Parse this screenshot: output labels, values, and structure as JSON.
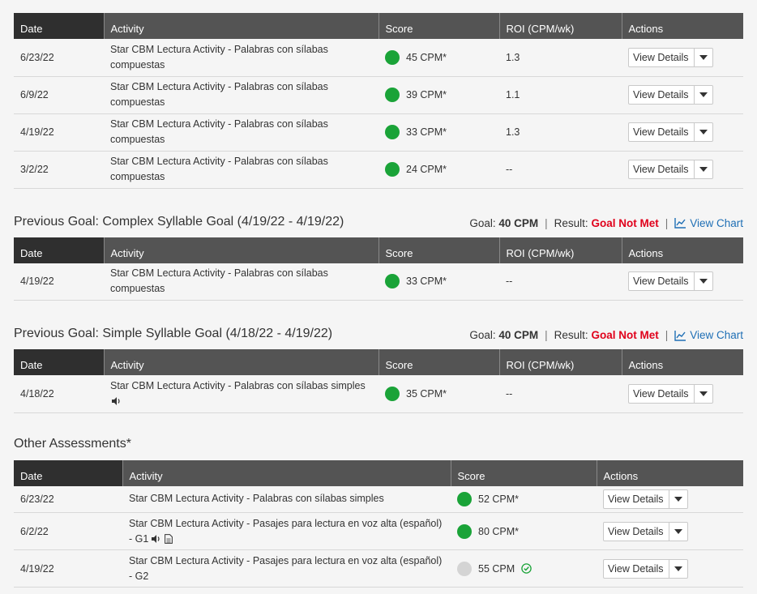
{
  "headers": {
    "date": "Date",
    "activity": "Activity",
    "score": "Score",
    "roi": "ROI (CPM/wk)",
    "actions": "Actions"
  },
  "view_details_label": "View Details",
  "current_rows": [
    {
      "date": "6/23/22",
      "activity": "Star CBM Lectura Activity - Palabras con sílabas compuestas",
      "score": "45 CPM*",
      "roi": "1.3"
    },
    {
      "date": "6/9/22",
      "activity": "Star CBM Lectura Activity - Palabras con sílabas compuestas",
      "score": "39 CPM*",
      "roi": "1.1"
    },
    {
      "date": "4/19/22",
      "activity": "Star CBM Lectura Activity - Palabras con sílabas compuestas",
      "score": "33 CPM*",
      "roi": "1.3"
    },
    {
      "date": "3/2/22",
      "activity": "Star CBM Lectura Activity - Palabras con sílabas compuestas",
      "score": "24 CPM*",
      "roi": "--"
    }
  ],
  "goal1": {
    "title": "Previous Goal: Complex Syllable Goal (4/19/22 - 4/19/22)",
    "goal_label": "Goal:",
    "goal_value": "40 CPM",
    "result_label": "Result:",
    "result_value": "Goal Not Met",
    "view_chart": "View Chart",
    "rows": [
      {
        "date": "4/19/22",
        "activity": "Star CBM Lectura Activity - Palabras con sílabas compuestas",
        "score": "33 CPM*",
        "roi": "--"
      }
    ]
  },
  "goal2": {
    "title": "Previous Goal: Simple Syllable Goal (4/18/22 - 4/19/22)",
    "goal_label": "Goal:",
    "goal_value": "40 CPM",
    "result_label": "Result:",
    "result_value": "Goal Not Met",
    "view_chart": "View Chart",
    "rows": [
      {
        "date": "4/18/22",
        "activity": "Star CBM Lectura Activity - Palabras con sílabas simples",
        "score": "35 CPM*",
        "roi": "--"
      }
    ]
  },
  "other": {
    "title": "Other Assessments*",
    "rows": [
      {
        "date": "6/23/22",
        "activity": "Star CBM Lectura Activity - Palabras con sílabas simples",
        "score": "52 CPM*"
      },
      {
        "date": "6/2/22",
        "activity": "Star CBM Lectura Activity - Pasajes para lectura en voz alta (español) - G1",
        "score": "80 CPM*"
      },
      {
        "date": "4/19/22",
        "activity": "Star CBM Lectura Activity - Pasajes para lectura en voz alta (español) - G2",
        "score": "55 CPM"
      }
    ]
  },
  "colors": {
    "score_dot_green": "#1aa338",
    "score_dot_gray": "#d4d4d4",
    "goal_not_met": "#e0001b",
    "link": "#1f6fb5",
    "header_bg": "#545454",
    "header_first_bg": "#2f2f2f"
  },
  "icons": {
    "dropdown": "caret-down-icon",
    "chart": "line-chart-icon",
    "audio": "speaker-icon",
    "document": "document-icon",
    "check": "check-circle-icon"
  }
}
